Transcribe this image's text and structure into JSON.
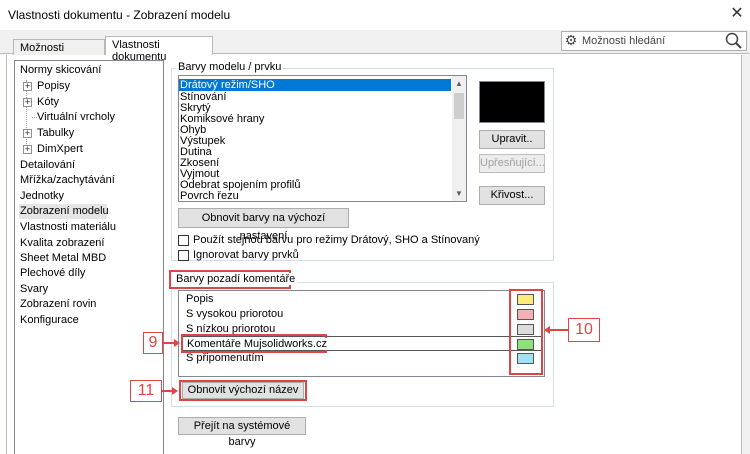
{
  "window": {
    "title": "Vlastnosti dokumentu - Zobrazení modelu",
    "close_glyph": "✕"
  },
  "tabs": [
    {
      "label": "Možnosti systému"
    },
    {
      "label": "Vlastnosti dokumentu"
    }
  ],
  "search": {
    "placeholder": "Možnosti hledání",
    "gear_glyph": "⚙"
  },
  "tree": {
    "items": [
      {
        "label": "Normy skicování"
      },
      {
        "label": "Popisy",
        "expander": "+"
      },
      {
        "label": "Kóty",
        "expander": "+"
      },
      {
        "label": "Virtuální vrcholy"
      },
      {
        "label": "Tabulky",
        "expander": "+"
      },
      {
        "label": "DimXpert",
        "expander": "+"
      },
      {
        "label": "Detailování"
      },
      {
        "label": "Mřížka/zachytávání"
      },
      {
        "label": "Jednotky"
      },
      {
        "label": "Zobrazení modelu",
        "selected": true
      },
      {
        "label": "Vlastnosti materiálu"
      },
      {
        "label": "Kvalita zobrazení"
      },
      {
        "label": "Sheet Metal MBD"
      },
      {
        "label": "Plechové díly"
      },
      {
        "label": "Svary"
      },
      {
        "label": "Zobrazení rovin"
      },
      {
        "label": "Konfigurace"
      }
    ]
  },
  "model_colors": {
    "group_label": "Barvy modelu / prvku",
    "items": [
      "Drátový režim/SHO",
      "Stínování",
      "Skrytý",
      "Komiksové hrany",
      "Ohyb",
      "Výstupek",
      "Dutina",
      "Zkosení",
      "Vyjmout",
      "Odebrat spojením profilů",
      "Povrch řezu"
    ],
    "selected_index": 0,
    "swatch_color": "#000000",
    "edit_button": "Upravit..",
    "refine_button": "Upřesňující...",
    "curve_button": "Křivost...",
    "reset_button": "Obnovit barvy na výchozí nastavení",
    "checkbox_same_color": "Použít stejnou barvu pro režimy Drátový, SHO a Stínovaný",
    "checkbox_ignore": "Ignorovat barvy prvků"
  },
  "annotation_colors": {
    "group_label": "Barvy pozadí komentáře",
    "rows": [
      {
        "label": "Popis",
        "color": "#ffeb7a"
      },
      {
        "label": "S vysokou priorotou",
        "color": "#f4b1b5"
      },
      {
        "label": "S nízkou priorotou",
        "color": "#dcdcdc"
      },
      {
        "label": "Komentáře Mujsolidworks.cz",
        "color": "#8ee07a"
      },
      {
        "label": "S připomenutím",
        "color": "#9fe1f5"
      }
    ],
    "reset_name_button": "Obnovit výchozí název"
  },
  "system_colors_button": "Přejít na systémové barvy",
  "callouts": {
    "n9": "9",
    "n10": "10",
    "n11": "11",
    "color": "#e04545"
  }
}
